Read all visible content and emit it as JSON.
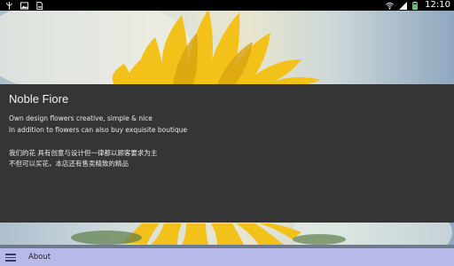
{
  "status_bar": {
    "time": "12:10",
    "left_icons": [
      "usb-icon",
      "image-icon",
      "file-icon"
    ],
    "right_icons": [
      "wifi-icon",
      "signal-icon",
      "battery-icon"
    ]
  },
  "card": {
    "title": "Noble Fiore",
    "lines": [
      "Own design flowers creative, simple & nice",
      "In addition to flowers can also buy exquisite boutique",
      "我们的花 具有创意与设计但一律都以顾客要求为主",
      "不但可以买花，本店还有售卖精致的精品"
    ]
  },
  "bottom_bar": {
    "menu_icon": "menu-icon",
    "label": "About"
  },
  "colors": {
    "card_bg": "#353535",
    "bottom_bar_bg": "#b7b9e9",
    "status_bar_bg": "#000000"
  }
}
